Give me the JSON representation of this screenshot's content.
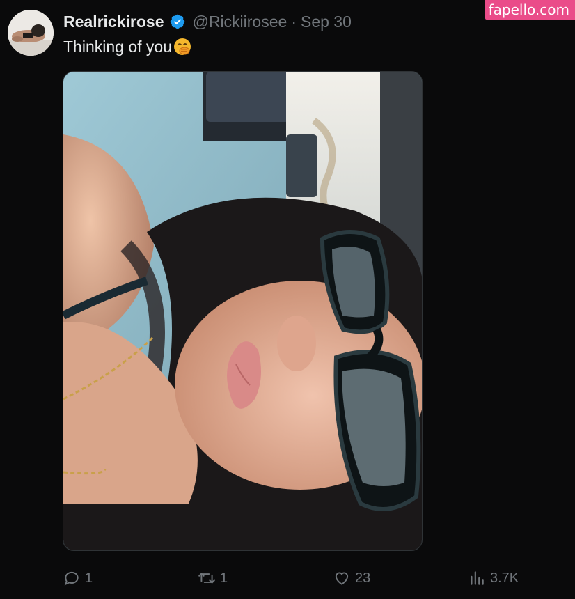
{
  "watermark": "fapello.com",
  "tweet": {
    "display_name": "Realrickirose",
    "handle": "@Rickiirosee",
    "separator": "·",
    "date": "Sep 30",
    "text": "Thinking of you",
    "emoji": "face-with-hand-over-mouth"
  },
  "media": {
    "description_icon": "photo"
  },
  "actions": {
    "reply_count": "1",
    "retweet_count": "1",
    "like_count": "23",
    "views_count": "3.7K"
  },
  "colors": {
    "background": "#0a0a0b",
    "text": "#e7e9ea",
    "muted": "#71767b",
    "verified": "#1d9bf0",
    "watermark": "#ea4c89"
  }
}
